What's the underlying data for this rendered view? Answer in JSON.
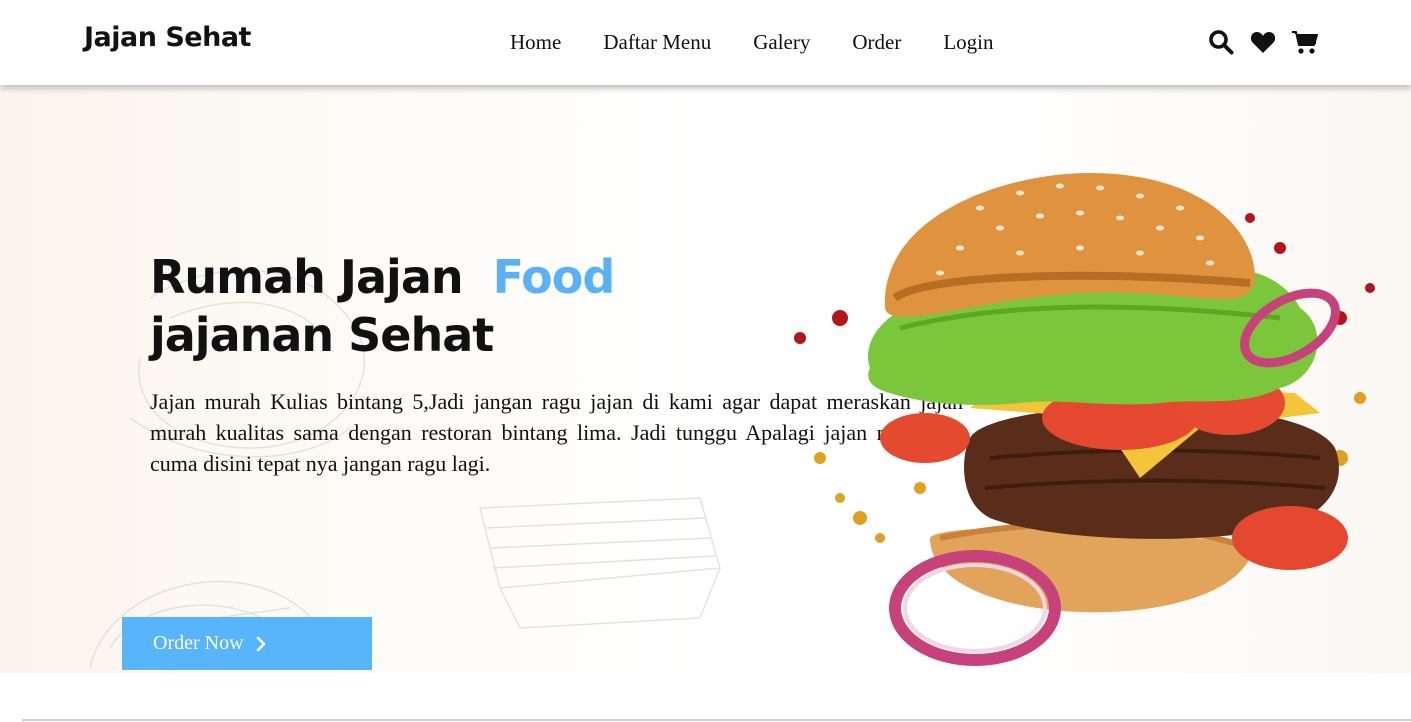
{
  "brand": {
    "logo": "Jajan Sehat"
  },
  "nav": {
    "items": [
      "Home",
      "Daftar Menu",
      "Galery",
      "Order",
      "Login"
    ]
  },
  "header_icons": [
    "search-icon",
    "heart-icon",
    "cart-icon"
  ],
  "hero": {
    "title_line1": "Rumah Jajan",
    "title_accent": "Food",
    "title_line2": "jajanan Sehat",
    "description": "Jajan murah Kulias bintang 5,Jadi jangan ragu jajan di kami agar dapat meraskan jajan murah kualitas sama dengan restoran bintang lima. Jadi tunggu Apalagi jajan murah ya cuma disini tepat nya jangan ragu lagi.",
    "cta_label": "Order Now"
  },
  "colors": {
    "accent": "#5ab1f7",
    "button": "#58b4fb",
    "text": "#111111"
  }
}
